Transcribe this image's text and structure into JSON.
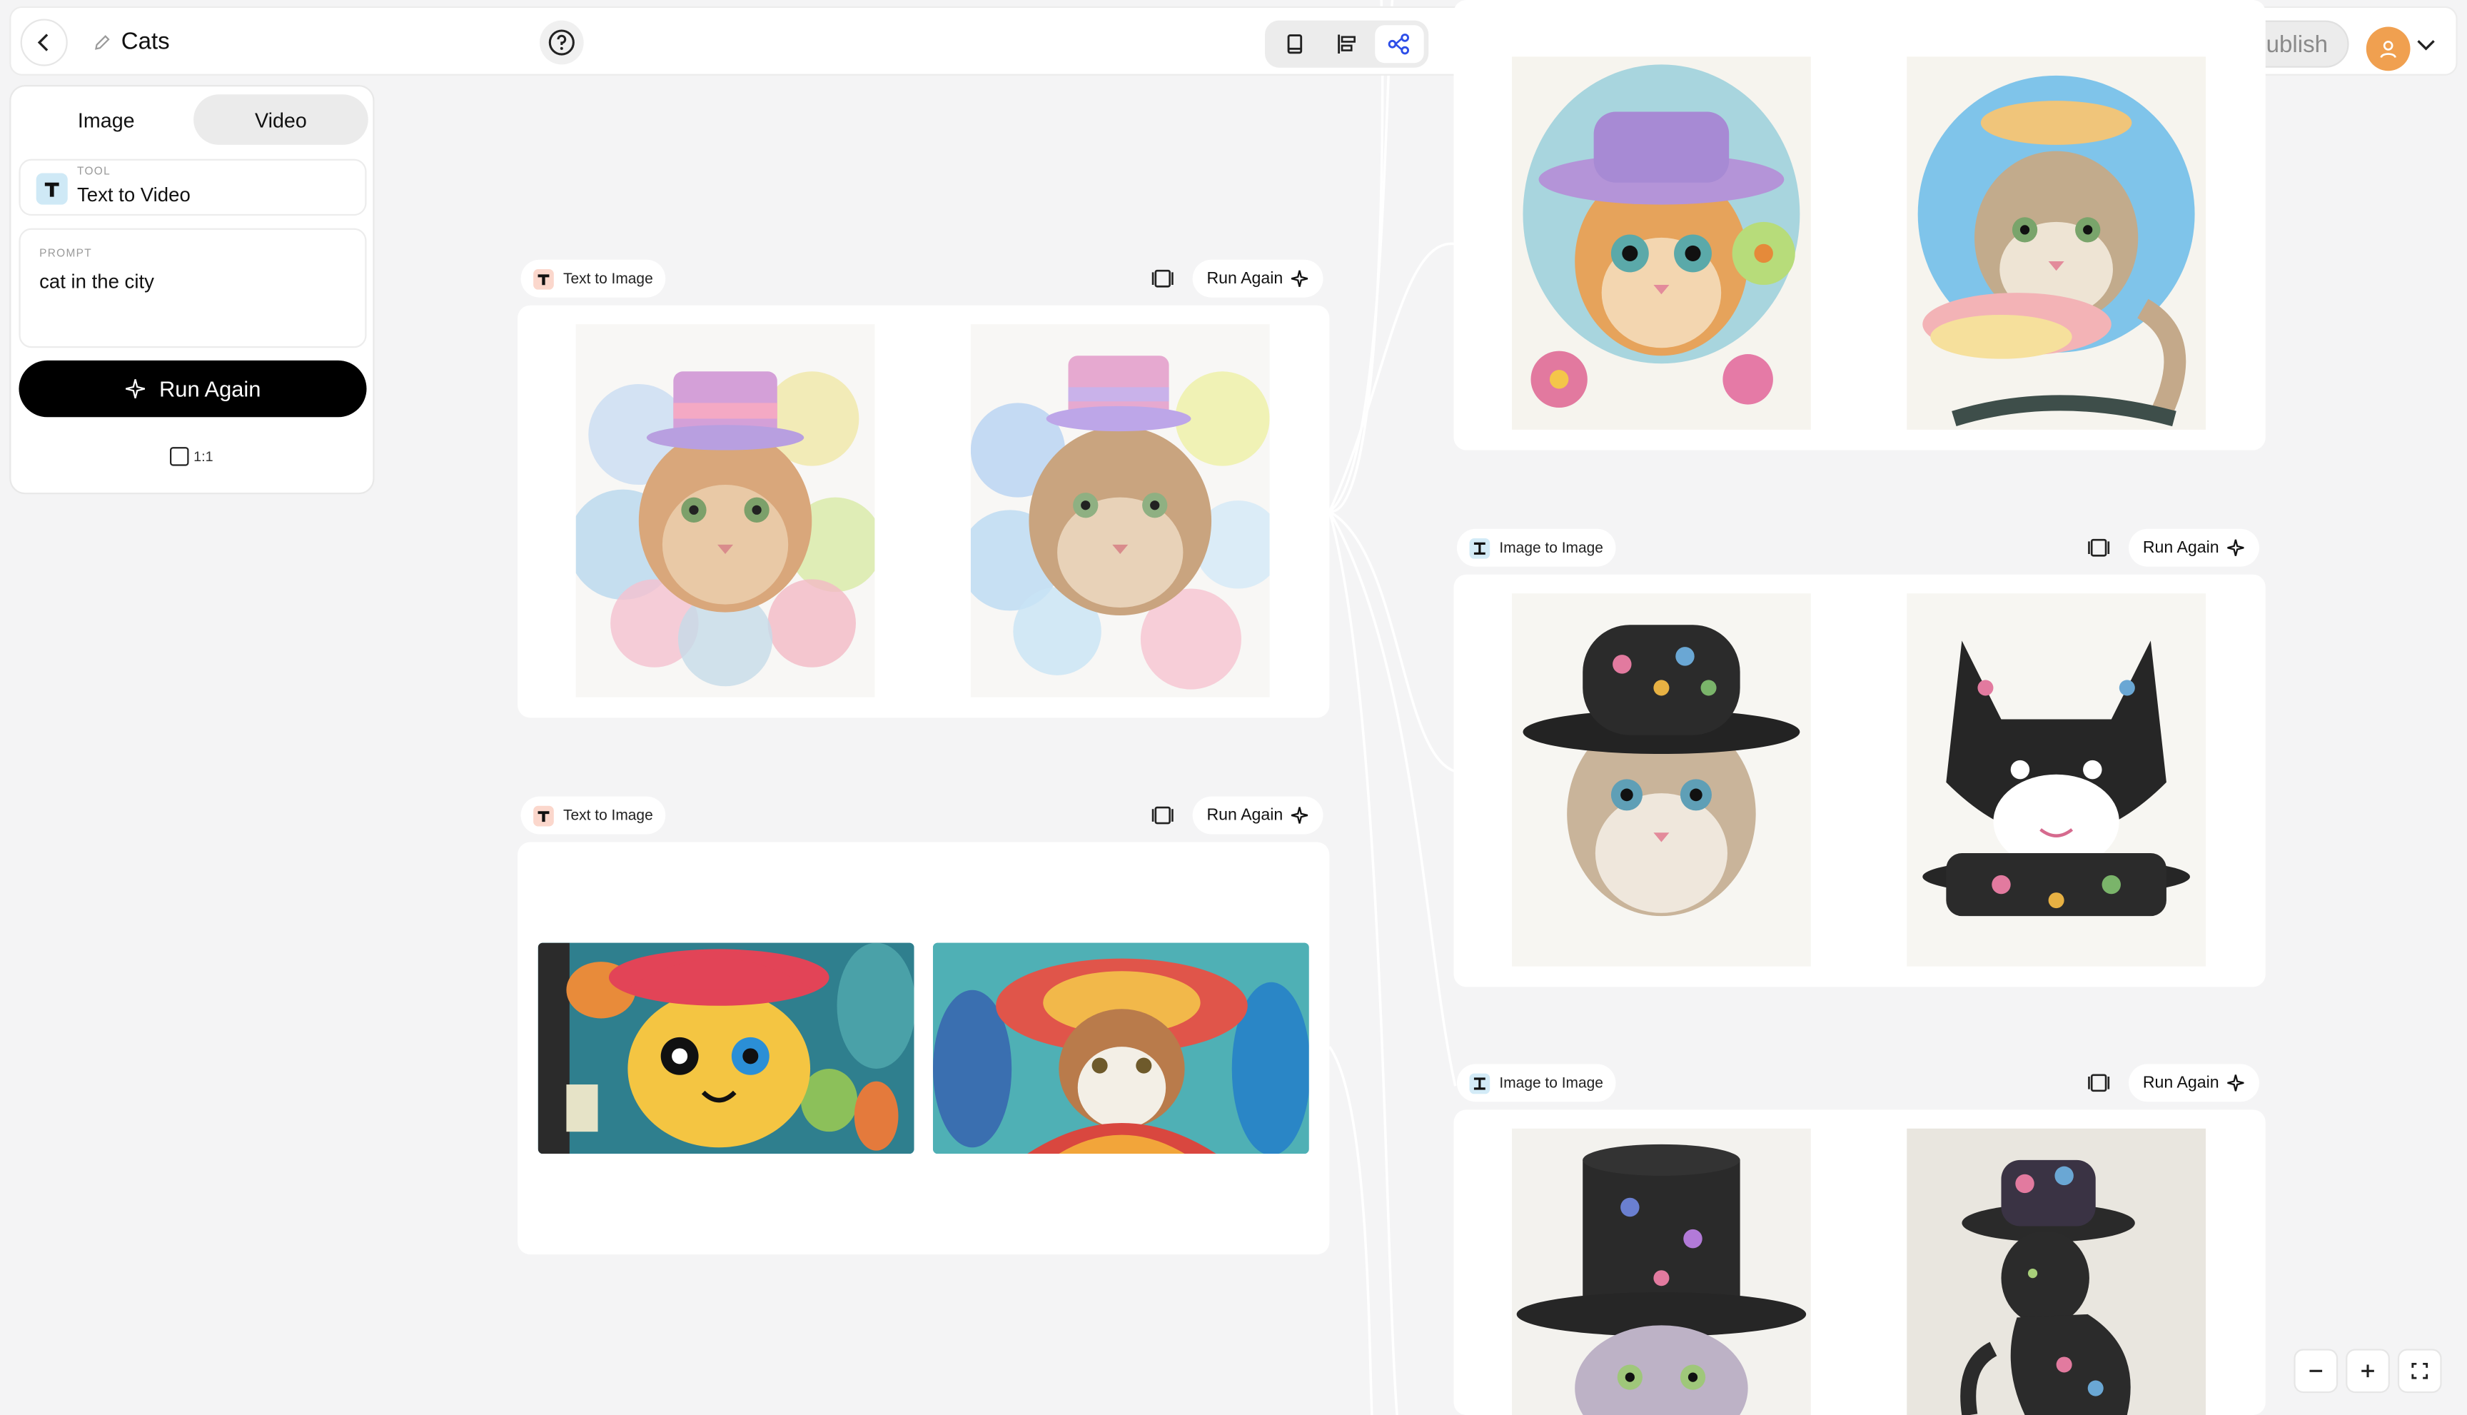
{
  "header": {
    "project_title": "Cats",
    "publish_label": "Publish"
  },
  "left_panel": {
    "tabs": [
      {
        "label": "Image",
        "active": false
      },
      {
        "label": "Video",
        "active": true
      }
    ],
    "tool": {
      "label": "TOOL",
      "value": "Text to Video"
    },
    "prompt": {
      "label": "PROMPT",
      "value": "cat in the city"
    },
    "run_label": "Run Again",
    "aspect_ratio": "1:1"
  },
  "nodes": [
    {
      "tool": "Text to Image",
      "run_label": "Run Again"
    },
    {
      "tool": "Text to Image",
      "run_label": "Run Again"
    },
    {
      "tool": "Image to Image",
      "run_label": "Run Again"
    },
    {
      "tool": "Image to Image",
      "run_label": "Run Again"
    }
  ],
  "colors": {
    "accent": "#2d4ee8",
    "avatar": "#f0a050",
    "run_button": "#000000"
  }
}
